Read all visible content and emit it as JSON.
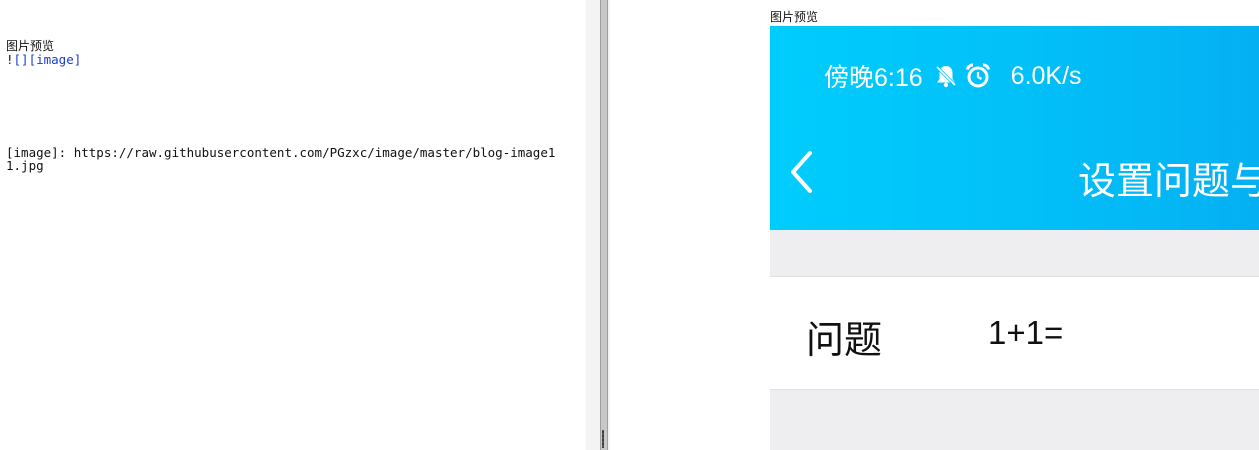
{
  "editor": {
    "heading": "图片预览",
    "image_tag_prefix": "!",
    "image_tag_link": "[][image]",
    "reference_line": "[image]: https://raw.githubusercontent.com/PGzxc/image/master/blog-image11.jpg"
  },
  "preview": {
    "label": "图片预览",
    "phone": {
      "status_bar": {
        "time": "傍晚6:16",
        "icons": [
          "bell-off-icon",
          "alarm-clock-icon"
        ],
        "network_speed": "6.0K/s"
      },
      "nav": {
        "back_icon": "chevron-left-icon",
        "title": "设置问题与"
      },
      "form": {
        "question_label": "问题",
        "question_value": "1+1="
      },
      "colors": {
        "header_start": "#00cdfd",
        "header_end": "#05b0f2",
        "page_background": "#eeeef1",
        "row_background": "#ffffff"
      }
    }
  }
}
